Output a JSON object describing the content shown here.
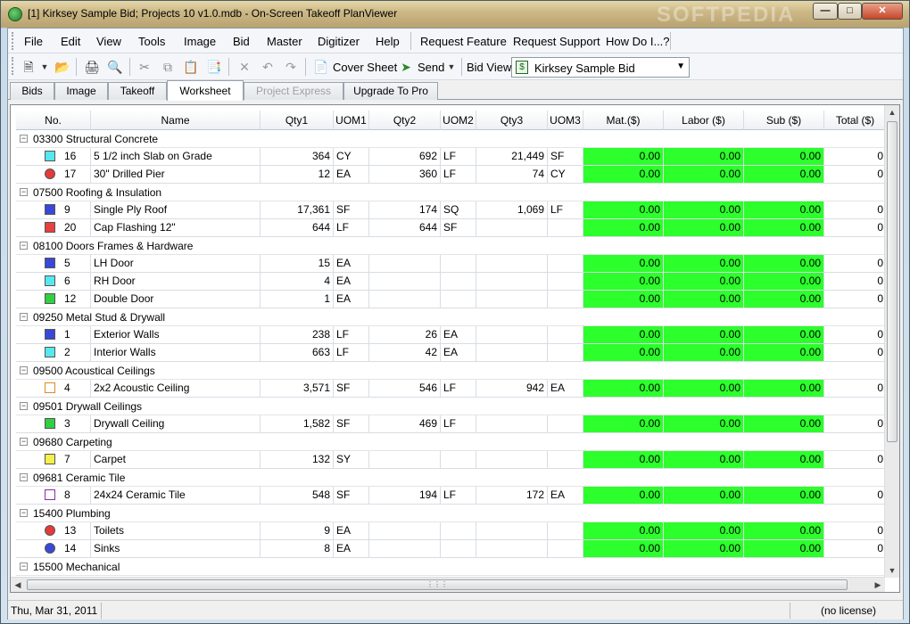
{
  "window": {
    "title": "[1] Kirksey Sample Bid; Projects 10 v1.0.mdb - On-Screen Takeoff PlanViewer",
    "watermark": "SOFTPEDIA"
  },
  "menubar": {
    "items": [
      "File",
      "Edit",
      "View",
      "Tools",
      "Image",
      "Bid",
      "Master",
      "Digitizer",
      "Help",
      "Request Feature",
      "Request Support",
      "How Do I...?"
    ]
  },
  "toolbar": {
    "cover_sheet_label": "Cover Sheet",
    "send_label": "Send",
    "bid_view_label": "Bid View",
    "bid_view_value": "Kirksey Sample Bid"
  },
  "tabs": [
    {
      "label": "Bids",
      "state": "normal"
    },
    {
      "label": "Image",
      "state": "normal"
    },
    {
      "label": "Takeoff",
      "state": "normal"
    },
    {
      "label": "Worksheet",
      "state": "active"
    },
    {
      "label": "Project Express",
      "state": "disabled"
    },
    {
      "label": "Upgrade To Pro",
      "state": "normal"
    }
  ],
  "grid": {
    "columns": [
      "No.",
      "Name",
      "Qty1",
      "UOM1",
      "Qty2",
      "UOM2",
      "Qty3",
      "UOM3",
      "Mat.($)",
      "Labor ($)",
      "Sub ($)",
      "Total ($)"
    ],
    "highlight_color": "#2cff2c",
    "groups": [
      {
        "label": "03300  Structural Concrete",
        "items": [
          {
            "no": "16",
            "name": "5 1/2 inch Slab on Grade",
            "qty1": "364",
            "uom1": "CY",
            "qty2": "692",
            "uom2": "LF",
            "qty3": "21,449",
            "uom3": "SF",
            "mat": "0.00",
            "labor": "0.00",
            "sub": "0.00",
            "total": "0",
            "swatch": {
              "color": "#56e8ee",
              "shape": "square"
            }
          },
          {
            "no": "17",
            "name": "30\" Drilled Pier",
            "qty1": "12",
            "uom1": "EA",
            "qty2": "360",
            "uom2": "LF",
            "qty3": "74",
            "uom3": "CY",
            "mat": "0.00",
            "labor": "0.00",
            "sub": "0.00",
            "total": "0",
            "swatch": {
              "color": "#e53a3a",
              "shape": "circle"
            }
          }
        ]
      },
      {
        "label": "07500  Roofing & Insulation",
        "items": [
          {
            "no": "9",
            "name": "Single Ply Roof",
            "qty1": "17,361",
            "uom1": "SF",
            "qty2": "174",
            "uom2": "SQ",
            "qty3": "1,069",
            "uom3": "LF",
            "mat": "0.00",
            "labor": "0.00",
            "sub": "0.00",
            "total": "0",
            "swatch": {
              "color": "#3848d8",
              "shape": "square"
            }
          },
          {
            "no": "20",
            "name": "Cap Flashing 12\"",
            "qty1": "644",
            "uom1": "LF",
            "qty2": "644",
            "uom2": "SF",
            "qty3": "",
            "uom3": "",
            "mat": "0.00",
            "labor": "0.00",
            "sub": "0.00",
            "total": "0",
            "swatch": {
              "color": "#e84040",
              "shape": "square"
            }
          }
        ]
      },
      {
        "label": "08100  Doors Frames & Hardware",
        "items": [
          {
            "no": "5",
            "name": "LH Door",
            "qty1": "15",
            "uom1": "EA",
            "qty2": "",
            "uom2": "",
            "qty3": "",
            "uom3": "",
            "mat": "0.00",
            "labor": "0.00",
            "sub": "0.00",
            "total": "0",
            "swatch": {
              "color": "#3848d8",
              "shape": "square"
            }
          },
          {
            "no": "6",
            "name": "RH Door",
            "qty1": "4",
            "uom1": "EA",
            "qty2": "",
            "uom2": "",
            "qty3": "",
            "uom3": "",
            "mat": "0.00",
            "labor": "0.00",
            "sub": "0.00",
            "total": "0",
            "swatch": {
              "color": "#56e8ee",
              "shape": "square"
            }
          },
          {
            "no": "12",
            "name": "Double Door",
            "qty1": "1",
            "uom1": "EA",
            "qty2": "",
            "uom2": "",
            "qty3": "",
            "uom3": "",
            "mat": "0.00",
            "labor": "0.00",
            "sub": "0.00",
            "total": "0",
            "swatch": {
              "color": "#30d040",
              "shape": "square"
            }
          }
        ]
      },
      {
        "label": "09250  Metal Stud & Drywall",
        "items": [
          {
            "no": "1",
            "name": "Exterior  Walls",
            "qty1": "238",
            "uom1": "LF",
            "qty2": "26",
            "uom2": "EA",
            "qty3": "",
            "uom3": "",
            "mat": "0.00",
            "labor": "0.00",
            "sub": "0.00",
            "total": "0",
            "swatch": {
              "color": "#3848d8",
              "shape": "square"
            }
          },
          {
            "no": "2",
            "name": "Interior  Walls",
            "qty1": "663",
            "uom1": "LF",
            "qty2": "42",
            "uom2": "EA",
            "qty3": "",
            "uom3": "",
            "mat": "0.00",
            "labor": "0.00",
            "sub": "0.00",
            "total": "0",
            "swatch": {
              "color": "#56e8ee",
              "shape": "square"
            }
          }
        ]
      },
      {
        "label": "09500  Acoustical Ceilings",
        "items": [
          {
            "no": "4",
            "name": "2x2 Acoustic Ceiling",
            "qty1": "3,571",
            "uom1": "SF",
            "qty2": "546",
            "uom2": "LF",
            "qty3": "942",
            "uom3": "EA",
            "mat": "0.00",
            "labor": "0.00",
            "sub": "0.00",
            "total": "0",
            "swatch": {
              "color": "#ffffff",
              "shape": "square-orange"
            }
          }
        ]
      },
      {
        "label": "09501  Drywall Ceilings",
        "items": [
          {
            "no": "3",
            "name": "Drywall Ceiling",
            "qty1": "1,582",
            "uom1": "SF",
            "qty2": "469",
            "uom2": "LF",
            "qty3": "",
            "uom3": "",
            "mat": "0.00",
            "labor": "0.00",
            "sub": "0.00",
            "total": "0",
            "swatch": {
              "color": "#30d040",
              "shape": "square"
            }
          }
        ]
      },
      {
        "label": "09680  Carpeting",
        "items": [
          {
            "no": "7",
            "name": "Carpet",
            "qty1": "132",
            "uom1": "SY",
            "qty2": "",
            "uom2": "",
            "qty3": "",
            "uom3": "",
            "mat": "0.00",
            "labor": "0.00",
            "sub": "0.00",
            "total": "0",
            "swatch": {
              "color": "#f5f04a",
              "shape": "square"
            }
          }
        ]
      },
      {
        "label": "09681  Ceramic Tile",
        "items": [
          {
            "no": "8",
            "name": "24x24 Ceramic Tile",
            "qty1": "548",
            "uom1": "SF",
            "qty2": "194",
            "uom2": "LF",
            "qty3": "172",
            "uom3": "EA",
            "mat": "0.00",
            "labor": "0.00",
            "sub": "0.00",
            "total": "0",
            "swatch": {
              "color": "#ffffff",
              "shape": "square-purple"
            }
          }
        ]
      },
      {
        "label": "15400  Plumbing",
        "items": [
          {
            "no": "13",
            "name": "Toilets",
            "qty1": "9",
            "uom1": "EA",
            "qty2": "",
            "uom2": "",
            "qty3": "",
            "uom3": "",
            "mat": "0.00",
            "labor": "0.00",
            "sub": "0.00",
            "total": "0",
            "swatch": {
              "color": "#e53a3a",
              "shape": "circle"
            }
          },
          {
            "no": "14",
            "name": "Sinks",
            "qty1": "8",
            "uom1": "EA",
            "qty2": "",
            "uom2": "",
            "qty3": "",
            "uom3": "",
            "mat": "0.00",
            "labor": "0.00",
            "sub": "0.00",
            "total": "0",
            "swatch": {
              "color": "#3848d8",
              "shape": "circle"
            }
          }
        ]
      },
      {
        "label": "15500  Mechanical",
        "items": []
      }
    ]
  },
  "statusbar": {
    "date": "Thu, Mar 31, 2011",
    "license": "(no license)"
  }
}
